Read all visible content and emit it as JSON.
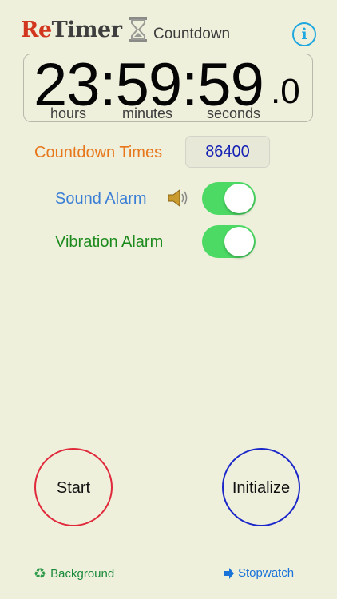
{
  "header": {
    "logo_re": "Re",
    "logo_timer": "Timer",
    "mode": "Countdown",
    "info_icon": "i"
  },
  "timer": {
    "digits": "23:59:59",
    "tenths": ".0",
    "units": {
      "hours": "hours",
      "minutes": "minutes",
      "seconds": "seconds"
    }
  },
  "countdown": {
    "label": "Countdown Times",
    "value": "86400"
  },
  "alarms": {
    "sound": {
      "label": "Sound Alarm",
      "on": true,
      "icon": "speaker-icon"
    },
    "vibration": {
      "label": "Vibration Alarm",
      "on": true
    }
  },
  "buttons": {
    "start": "Start",
    "initialize": "Initialize"
  },
  "footer": {
    "background": "Background",
    "stopwatch": "Stopwatch"
  },
  "colors": {
    "background": "#eef0dc",
    "toggle_on": "#4cd964",
    "start_ring": "#e0293b",
    "init_ring": "#1a26c9"
  }
}
